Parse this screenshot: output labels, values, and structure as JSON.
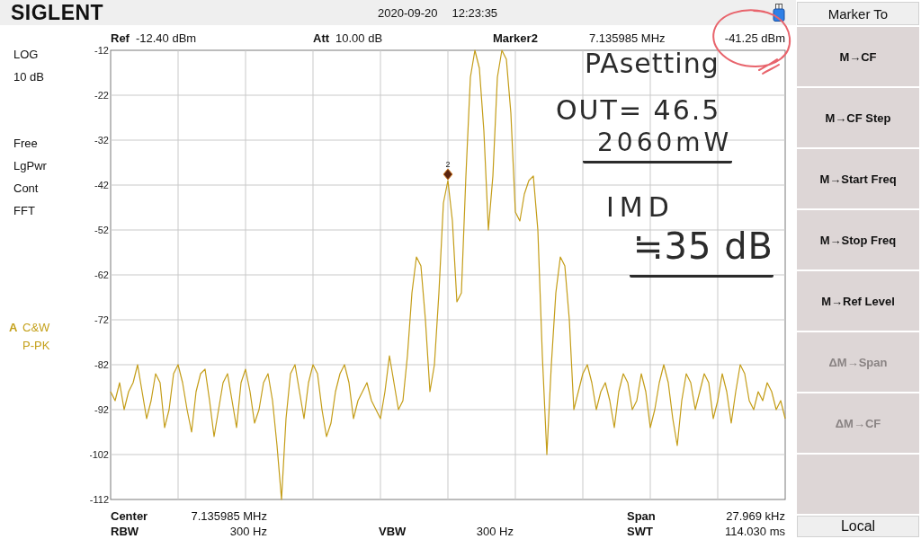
{
  "header": {
    "logo": "SIGLENT",
    "date": "2020-09-20",
    "time": "12:23:35"
  },
  "readouts": {
    "ref": {
      "label": "Ref",
      "value": "-12.40 dBm"
    },
    "att": {
      "label": "Att",
      "value": "10.00 dB"
    },
    "marker": {
      "label": "Marker2",
      "frequency": "7.135985 MHz",
      "amplitude": "-41.25 dBm"
    }
  },
  "left_panel": {
    "scale": [
      "LOG",
      "10 dB"
    ],
    "status": [
      "Free",
      "LgPwr",
      "Cont",
      "FFT"
    ],
    "trace": {
      "name": "A",
      "mode": "C&W",
      "detector": "P-PK"
    }
  },
  "chart": {
    "chart_data": {
      "type": "line",
      "grid": true,
      "ylim": [
        -112,
        -12
      ],
      "yticks": [
        -12,
        -22,
        -32,
        -42,
        -52,
        -62,
        -72,
        -82,
        -92,
        -102,
        -112
      ],
      "values": [
        -88,
        -90,
        -86,
        -92,
        -88,
        -86,
        -82,
        -88,
        -94,
        -90,
        -84,
        -86,
        -96,
        -92,
        -84,
        -82,
        -86,
        -92,
        -97,
        -88,
        -84,
        -83,
        -90,
        -98,
        -92,
        -86,
        -84,
        -90,
        -96,
        -86,
        -83,
        -88,
        -95,
        -92,
        -86,
        -84,
        -90,
        -100,
        -112,
        -94,
        -84,
        -82,
        -88,
        -94,
        -86,
        -82,
        -84,
        -92,
        -98,
        -95,
        -88,
        -84,
        -82,
        -86,
        -94,
        -90,
        -88,
        -86,
        -90,
        -92,
        -94,
        -88,
        -80,
        -86,
        -92,
        -90,
        -80,
        -66,
        -58,
        -60,
        -72,
        -88,
        -82,
        -66,
        -46,
        -41,
        -50,
        -68,
        -66,
        -40,
        -18,
        -12,
        -16,
        -30,
        -52,
        -40,
        -18,
        -12,
        -14,
        -26,
        -48,
        -50,
        -44,
        -41,
        -40,
        -52,
        -80,
        -102,
        -82,
        -66,
        -58,
        -60,
        -72,
        -92,
        -88,
        -84,
        -82,
        -86,
        -92,
        -88,
        -86,
        -90,
        -96,
        -88,
        -84,
        -86,
        -92,
        -90,
        -84,
        -88,
        -96,
        -92,
        -86,
        -82,
        -86,
        -94,
        -100,
        -90,
        -84,
        -86,
        -92,
        -88,
        -84,
        -86,
        -94,
        -90,
        -84,
        -88,
        -95,
        -88,
        -82,
        -84,
        -90,
        -92,
        -88,
        -90,
        -86,
        -88,
        -92,
        -90,
        -94
      ],
      "annotations": [
        "2"
      ]
    }
  },
  "sweep": {
    "center": {
      "label": "Center",
      "value": "7.135985 MHz"
    },
    "span": {
      "label": "Span",
      "value": "27.969 kHz"
    },
    "rbw": {
      "label": "RBW",
      "value": "300 Hz"
    },
    "vbw": {
      "label": "VBW",
      "value": "300 Hz"
    },
    "swt": {
      "label": "SWT",
      "value": "114.030 ms"
    }
  },
  "menu": {
    "title": "Marker To",
    "buttons": [
      {
        "label": "M→CF",
        "disabled": false
      },
      {
        "label": "M→CF Step",
        "disabled": false
      },
      {
        "label": "M→Start Freq",
        "disabled": false
      },
      {
        "label": "M→Stop Freq",
        "disabled": false
      },
      {
        "label": "M→Ref Level",
        "disabled": false
      },
      {
        "label": "ΔM→Span",
        "disabled": true
      },
      {
        "label": "ΔM→CF",
        "disabled": true
      }
    ],
    "local": "Local"
  },
  "annotations": [
    {
      "text": "PAsetting",
      "underlined": false
    },
    {
      "text": "OUT= 46.5",
      "underlined": false
    },
    {
      "text": "2060mW",
      "underlined": true
    },
    {
      "text": "IMD",
      "underlined": false
    },
    {
      "text": "≒35 dB",
      "underlined": true
    }
  ]
}
